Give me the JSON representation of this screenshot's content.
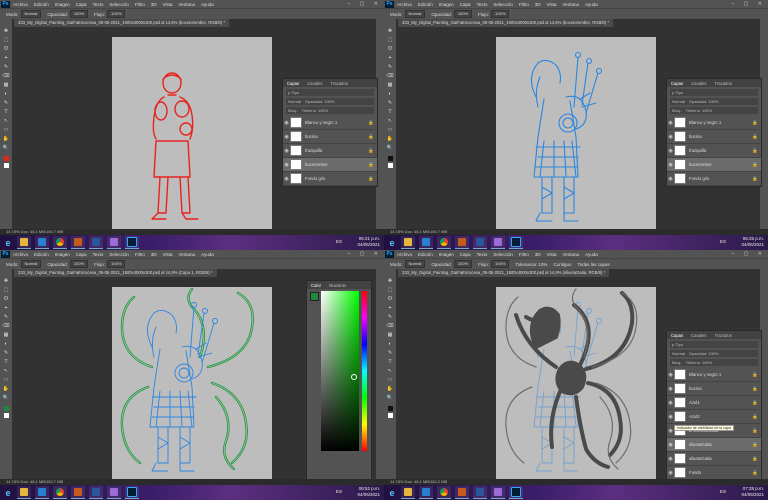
{
  "app": {
    "logo": "Ps",
    "menu": [
      "Archivo",
      "Edición",
      "Imagen",
      "Capa",
      "Texto",
      "Selección",
      "Filtro",
      "3D",
      "Vista",
      "Ventana",
      "Ayuda"
    ],
    "window_controls": "– ▢ ✕"
  },
  "options": {
    "mode_label": "Modo:",
    "mode_value": "Normal",
    "opacity_label": "Opacidad:",
    "opacity_value": "100%",
    "flow_label": "Flujo:",
    "flow_value": "100%"
  },
  "screens": [
    {
      "doc_tab": "333_My_Digital_Painting_GaiFaEscocesa_05-05-2021_1500x4000x300.psd al 14,8% (bocetorombre, RGB/8) *",
      "status": "14,78%   Doc: 48,1 MB/150,7 MB",
      "clock": {
        "time": "06:21 p.m.",
        "date": "04/05/2021"
      },
      "lang": "ES",
      "panel": {
        "tabs": [
          "Capas",
          "Canales",
          "Trazados"
        ],
        "filter": "ρ Tipo",
        "blend": "Normal",
        "opacity_label": "Opacidad: 100%",
        "lock_label": "Bloq.:",
        "fill_label": "Relleno: 100%",
        "layers": [
          {
            "name": "Blanco y negro 1",
            "selected": false
          },
          {
            "name": "bocina",
            "selected": false
          },
          {
            "name": "frazquilla",
            "selected": false
          },
          {
            "name": "bocetombre",
            "selected": true
          },
          {
            "name": "Fondo gris",
            "selected": false
          }
        ]
      }
    },
    {
      "doc_tab": "333_My_Digital_Painting_GaiFaEscocesa_05-05-2021_1500x4000x300.psd al 14,8% (bocetorombre, RGB/8) *",
      "status": "14,78%   Doc: 48,1 MB/150,7 MB",
      "clock": {
        "time": "06:25 p.m.",
        "date": "04/05/2021"
      },
      "lang": "ES",
      "panel": {
        "tabs": [
          "Capas",
          "Canales",
          "Trazados"
        ],
        "filter": "ρ Tipo",
        "blend": "Normal",
        "opacity_label": "Opacidad: 100%",
        "lock_label": "Bloq.:",
        "fill_label": "Relleno: 100%",
        "layers": [
          {
            "name": "Blanco y negro 1",
            "selected": false
          },
          {
            "name": "bocina",
            "selected": false
          },
          {
            "name": "frazquilla",
            "selected": false
          },
          {
            "name": "bocetombre",
            "selected": true
          },
          {
            "name": "Fondo gris",
            "selected": false
          }
        ]
      }
    },
    {
      "doc_tab": "333_My_Digital_Painting_GaiFaEscocesa_05-05-2021_1500x4000x300.psd al 14,8% (Capa 1, RGB/8) *",
      "status": "14,78%   Doc: 48,1 MB/152,7 MB",
      "clock": {
        "time": "06:52 p.m.",
        "date": "04/05/2021"
      },
      "lang": "ES",
      "color_panel": {
        "tabs": [
          "Color",
          "Muestras"
        ]
      }
    },
    {
      "doc_tab": "333_My_Digital_Painting_GaiFaEscocesa_05-05-2021_1500x4000x300.psd al 14,8% (siluetaGaita, RGB/8) *",
      "status": "14,78%   Doc: 48,1 MB/162,2 MB",
      "clock": {
        "time": "07:28 p.m.",
        "date": "04/05/2021"
      },
      "lang": "ES",
      "extra_options": {
        "tolerance": "Tolerancia: 10%",
        "contiguous": "Contiguo",
        "all_layers": "Todas las capas"
      },
      "panel": {
        "tabs": [
          "Capas",
          "Canales",
          "Trazados"
        ],
        "filter": "ρ Tipo",
        "blend": "Normal",
        "opacity_label": "Opacidad: 100%",
        "lock_label": "Bloq.:",
        "fill_label": "Relleno: 100%",
        "layers": [
          {
            "name": "Blanco y negro 1",
            "selected": false
          },
          {
            "name": "bocina",
            "selected": false
          },
          {
            "name": "Azul1",
            "selected": false
          },
          {
            "name": "Azul2",
            "selected": false
          },
          {
            "name": "bAzulIndoGaita",
            "selected": false
          },
          {
            "name": "siluetaGaita",
            "selected": true
          },
          {
            "name": "siluetaGaita",
            "selected": false
          },
          {
            "name": "Fondo",
            "selected": false
          }
        ],
        "tooltip": "Indicador de visibilidad de la capa"
      }
    }
  ],
  "colors": {
    "ps_bg": "#323232",
    "ps_chrome": "#535353",
    "canvas": "#bdbdbd",
    "sketch_red": "#e8231e",
    "sketch_blue": "#2a86e0",
    "sketch_green": "#1f8a3c",
    "silhouette": "#4a4a4a",
    "accent_blue": "#31a8ff"
  },
  "icons": [
    "move-icon",
    "marquee-icon",
    "lasso-icon",
    "brush-icon",
    "eraser-icon",
    "eye-icon",
    "lock-icon",
    "ie-icon",
    "chrome-icon",
    "word-icon",
    "photoshop-icon"
  ]
}
